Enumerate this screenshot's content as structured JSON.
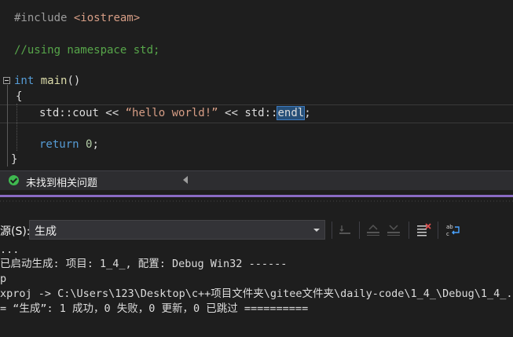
{
  "editor": {
    "line1": {
      "directive": "#include",
      "header": "<iostream>"
    },
    "line2": {
      "comment": "//using namespace std;"
    },
    "line3": {
      "type": "int",
      "name": "main",
      "parens": "()"
    },
    "line4": {
      "brace": "{"
    },
    "line5": {
      "ns1": "std::",
      "cout": "cout",
      "op1": " << ",
      "str": "“hello world!”",
      "op2": " << ",
      "ns2": "std::",
      "endl": "endl",
      "semi": ";"
    },
    "line6": {
      "kw": "return",
      "num": " 0",
      "semi": ";"
    },
    "line7": {
      "brace": "}"
    }
  },
  "status": {
    "text": "未找到相关问题"
  },
  "output": {
    "source_label": "源(S):",
    "source_value": "生成",
    "lines": [
      "...",
      "已启动生成: 项目: 1_4_, 配置: Debug Win32 ------",
      "p",
      "xproj -> C:\\Users\\123\\Desktop\\c++项目文件夹\\gitee文件夹\\daily-code\\1_4_\\Debug\\1_4_.",
      "= “生成”: 1 成功，0 失败，0 更新，0 已跳过 =========="
    ]
  },
  "icons": [
    "check-circle-icon",
    "scroll-left-icon",
    "dropdown-arrow-icon",
    "goto-prev-icon",
    "goto-next-icon",
    "clear-all-icon",
    "word-wrap-icon"
  ]
}
